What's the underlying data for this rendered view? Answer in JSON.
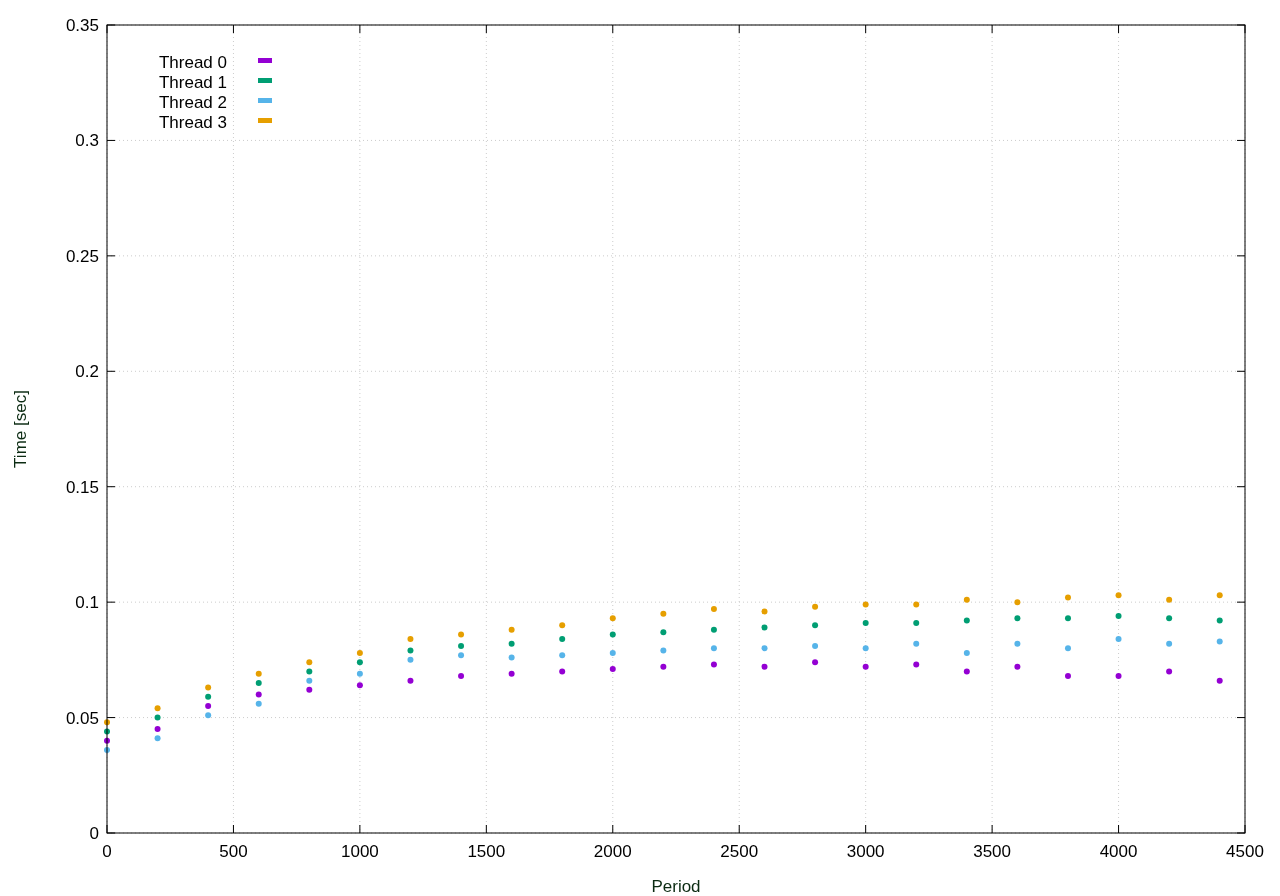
{
  "chart_data": {
    "type": "scatter",
    "xlabel": "Period",
    "ylabel": "Time [sec]",
    "xlim": [
      0,
      4500
    ],
    "ylim": [
      0,
      0.35
    ],
    "xticks": [
      0,
      500,
      1000,
      1500,
      2000,
      2500,
      3000,
      3500,
      4000,
      4500
    ],
    "yticks": [
      0,
      0.05,
      0.1,
      0.15,
      0.2,
      0.25,
      0.3,
      0.35
    ],
    "grid": true,
    "legend": true,
    "x": [
      0,
      200,
      400,
      600,
      800,
      1000,
      1200,
      1400,
      1600,
      1800,
      2000,
      2200,
      2400,
      2600,
      2800,
      3000,
      3200,
      3400,
      3600,
      3800,
      4000,
      4200,
      4400
    ],
    "series": [
      {
        "name": "Thread 0",
        "color": "#9400d3",
        "values": [
          0.04,
          0.045,
          0.055,
          0.06,
          0.062,
          0.064,
          0.066,
          0.068,
          0.069,
          0.07,
          0.071,
          0.072,
          0.073,
          0.072,
          0.074,
          0.072,
          0.073,
          0.07,
          0.072,
          0.068,
          0.068,
          0.07,
          0.066
        ]
      },
      {
        "name": "Thread 1",
        "color": "#009e73",
        "values": [
          0.044,
          0.05,
          0.059,
          0.065,
          0.07,
          0.074,
          0.079,
          0.081,
          0.082,
          0.084,
          0.086,
          0.087,
          0.088,
          0.089,
          0.09,
          0.091,
          0.091,
          0.092,
          0.093,
          0.093,
          0.094,
          0.093,
          0.092
        ]
      },
      {
        "name": "Thread 2",
        "color": "#56b4e9",
        "values": [
          0.036,
          0.041,
          0.051,
          0.056,
          0.066,
          0.069,
          0.075,
          0.077,
          0.076,
          0.077,
          0.078,
          0.079,
          0.08,
          0.08,
          0.081,
          0.08,
          0.082,
          0.078,
          0.082,
          0.08,
          0.084,
          0.082,
          0.083
        ]
      },
      {
        "name": "Thread 3",
        "color": "#e69f00",
        "values": [
          0.048,
          0.054,
          0.063,
          0.069,
          0.074,
          0.078,
          0.084,
          0.086,
          0.088,
          0.09,
          0.093,
          0.095,
          0.097,
          0.096,
          0.098,
          0.099,
          0.099,
          0.101,
          0.1,
          0.102,
          0.103,
          0.101,
          0.103
        ]
      }
    ]
  }
}
